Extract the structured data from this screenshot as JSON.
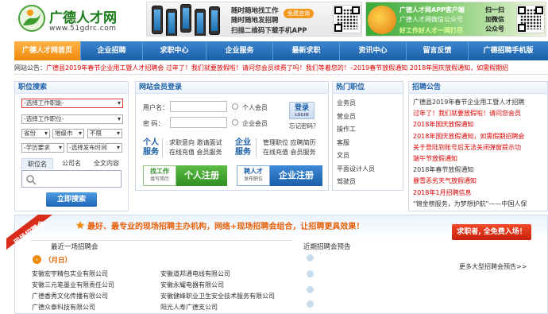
{
  "header": {
    "logo_text": "广德人才网",
    "logo_url": "www.51gdrc.com",
    "app_banner": {
      "line1": "随时随地找工作",
      "line2": "随时随地发招聘",
      "line3": "扫描二维码下载手机APP",
      "badge": "免费咨询"
    },
    "wx_banner": {
      "line1": "广德人才网APP客户端",
      "line2": "广德人才网微信公众号",
      "line3": "好工作好人才一网打尽",
      "side1": "扫一扫",
      "side2": "加微信",
      "side3": "公众号"
    }
  },
  "nav": [
    {
      "label": "广德人才网首页",
      "active": true
    },
    {
      "label": "企业招聘",
      "active": false
    },
    {
      "label": "求职中心",
      "active": false
    },
    {
      "label": "企业服务",
      "active": false
    },
    {
      "label": "最新求职",
      "active": false
    },
    {
      "label": "资讯中心",
      "active": false
    },
    {
      "label": "留言反馈",
      "active": false
    },
    {
      "label": "广德招聘手机版",
      "active": false
    }
  ],
  "notice": {
    "label": "网站公告：",
    "text": "广德县2019年春节企业用工暨人才招聘会   过年了！我们就要放假啦！请问您会员续费了吗！我们等着您的！–2019春节放假通知   2018年国庆放假通知，如需假期招"
  },
  "search": {
    "title": "职位搜索",
    "sel_category": "-选择工作职能-",
    "sel_position": "-选择工作职位-",
    "sel_province": "省份",
    "sel_city": "地级市",
    "sel_limit": "不限",
    "sel_edu": "-学历要求",
    "sel_date": "-选择发布时间",
    "tabs": [
      "职位名",
      "公司名",
      "全文内容"
    ],
    "button": "立即搜索"
  },
  "login": {
    "title": "网站会员登录",
    "user_label": "用户名：",
    "pass_label": "密  码：",
    "radio_personal": "个人会员",
    "radio_company": "企业会员",
    "login_btn": "登录",
    "login_sub": "LOGIN",
    "forgot": "忘记密码？",
    "personal_service_title": "个人服务",
    "personal_service_desc": "求职意向 邀请面试 在线充值 会员服务",
    "company_service_title": "企业服务",
    "company_service_desc": "管理职位 应聘简历 在线充值 会员服务",
    "find_job_tag": "找工作",
    "find_job_sub": "填写简历",
    "personal_register": "个人注册",
    "hire_tag": "聘人才",
    "hire_sub": "发布职位",
    "company_register": "企业注册"
  },
  "hot_jobs": {
    "title": "热门职位",
    "items": [
      "业务员",
      "营业员",
      "操作工",
      "客服",
      "文员",
      "平面设计人员",
      "驾驶员"
    ]
  },
  "recruit_notice": {
    "title": "招聘公告",
    "items": [
      {
        "text": "广德县2019年春节企业用工暨人才招聘",
        "color": "#333333"
      },
      {
        "text": "过年了！我们就要放假啦！请问您会员",
        "color": "#dd0000"
      },
      {
        "text": "2018年国庆放假通知",
        "color": "#dd0000"
      },
      {
        "text": "2018年国庆放假通知，如需假期招聘会",
        "color": "#dd0000"
      },
      {
        "text": "关于登陆到账号后无法关闭弹窗提示功",
        "color": "#dd0000"
      },
      {
        "text": "端午节放假通知",
        "color": "#dd0000"
      },
      {
        "text": "2018年春节放假通知",
        "color": "#333333"
      },
      {
        "text": "暴雪恶劣天气放假通知",
        "color": "#dd0000"
      },
      {
        "text": "2018年1月招聘信息",
        "color": "#dd0000"
      },
      {
        "text": "\"锦金榜服务，为梦想护航\"——中国人保",
        "color": "#333333"
      }
    ]
  },
  "fair": {
    "ribbon": "现场招聘会",
    "slogan": "最好、最专业的现场招聘主办机构，网络+现场招聘会组合，让招聘更具效果！",
    "free_tag": "求职者, 全免费入场！",
    "recent_title": "最近一场招聘会",
    "date": "（月日）",
    "companies_left": [
      "安徽宏宇精包实业有限公司",
      "安徽三元笔墨业有限责任公司",
      "广德香秀文化传播有限公司",
      "广德众泰科技有限公司"
    ],
    "companies_right": [
      "安徽道邦通电线有限公司",
      "安徽永耀电器有限公司",
      "安徽健峰职业卫生安全技术服务有限公司",
      "阳光人寿广德支公司"
    ],
    "upcoming_title": "近期招聘会预告",
    "more_link": "更多大型招聘会预告>>"
  }
}
